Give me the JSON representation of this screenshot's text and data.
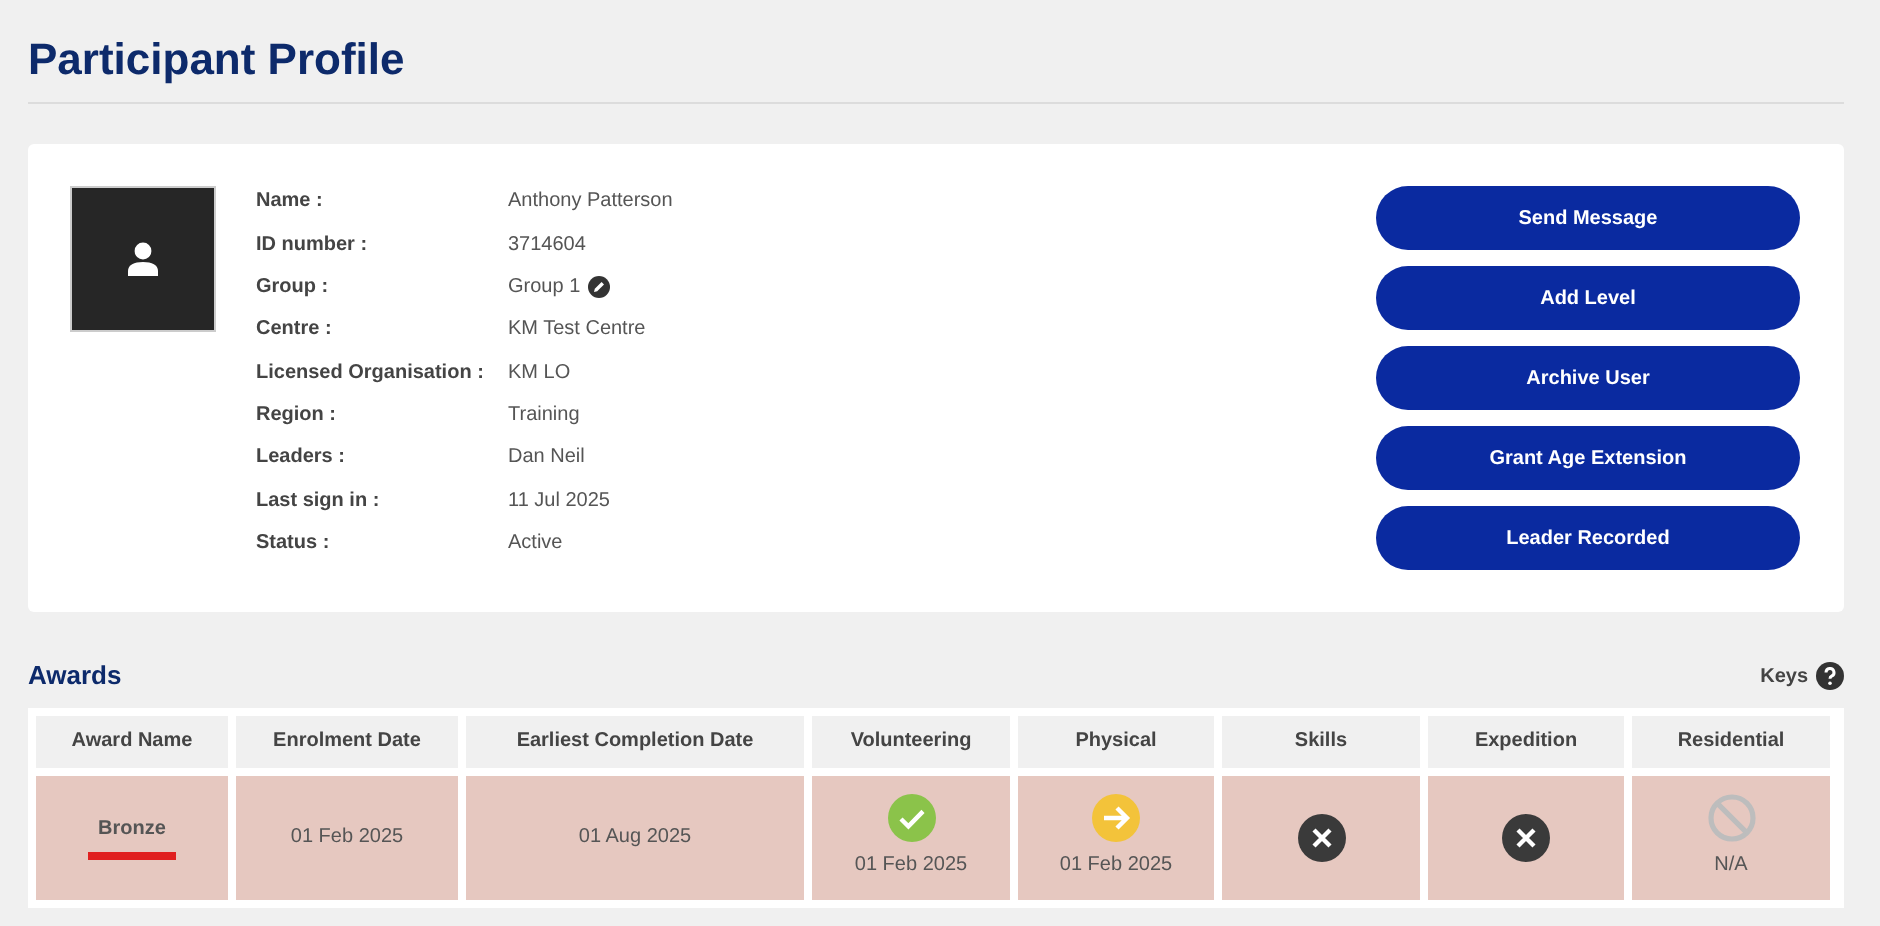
{
  "page_title": "Participant Profile",
  "profile": {
    "fields": [
      {
        "label": "Name :",
        "value": "Anthony Patterson"
      },
      {
        "label": "ID number :",
        "value": "3714604"
      },
      {
        "label": "Group :",
        "value": "Group 1",
        "editable": true
      },
      {
        "label": "Centre :",
        "value": "KM Test Centre"
      },
      {
        "label": "Licensed Organisation :",
        "value": "KM LO"
      },
      {
        "label": "Region :",
        "value": "Training"
      },
      {
        "label": "Leaders :",
        "value": "Dan Neil"
      },
      {
        "label": "Last sign in :",
        "value": "11 Jul 2025"
      },
      {
        "label": "Status :",
        "value": "Active"
      }
    ],
    "buttons": [
      "Send Message",
      "Add Level",
      "Archive User",
      "Grant Age Extension",
      "Leader Recorded"
    ]
  },
  "awards": {
    "title": "Awards",
    "keys_label": "Keys",
    "columns": [
      "Award Name",
      "Enrolment Date",
      "Earliest Completion Date",
      "Volunteering",
      "Physical",
      "Skills",
      "Expedition",
      "Residential"
    ],
    "rows": [
      {
        "award_name": "Bronze",
        "color": "#e02020",
        "enrolment_date": "01 Feb 2025",
        "earliest_completion_date": "01 Aug 2025",
        "sections": [
          {
            "kind": "complete",
            "text": "01 Feb 2025"
          },
          {
            "kind": "in_progress",
            "text": "01 Feb 2025"
          },
          {
            "kind": "not_started"
          },
          {
            "kind": "not_started"
          },
          {
            "kind": "not_applicable",
            "text": "N/A"
          }
        ]
      }
    ]
  }
}
